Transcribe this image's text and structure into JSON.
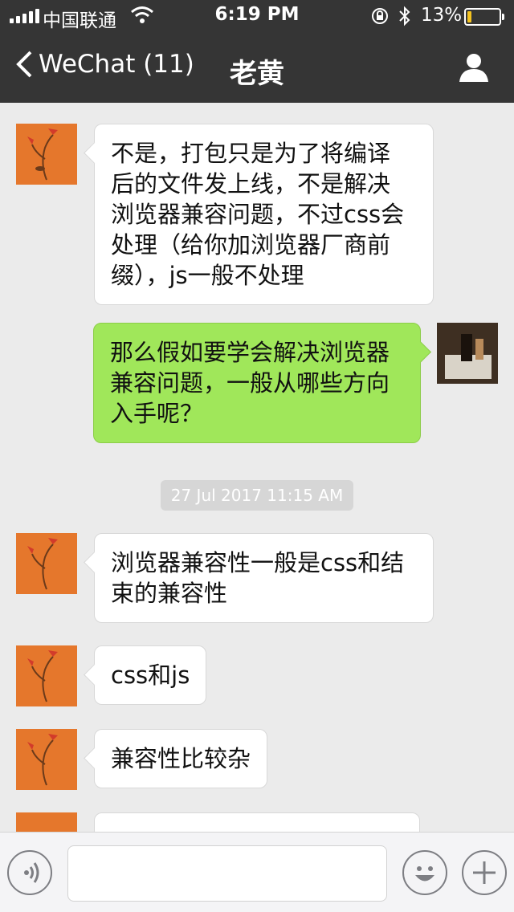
{
  "status_bar": {
    "carrier": "中国联通",
    "time": "6:19 PM",
    "battery_percent": "13%",
    "battery_level": 0.13,
    "battery_color": "#f4c320"
  },
  "nav": {
    "back_label": "WeChat (11)",
    "title": "老黄",
    "profile_icon": "person-icon"
  },
  "messages": [
    {
      "side": "in",
      "text": "不是，打包只是为了将编译\n后的文件发上线，不是解决\n浏览器兼容问题，不过css会\n处理（给你加浏览器厂商前\n缀），js一般不处理"
    },
    {
      "side": "out",
      "text": "那么假如要学会解决浏览器\n兼容问题，一般从哪些方向\n入手呢？"
    },
    {
      "side": "in",
      "text": "浏览器兼容性一般是css和结\n束的兼容性"
    },
    {
      "side": "in",
      "text": "css和js"
    },
    {
      "side": "in",
      "text": "兼容性比较杂"
    }
  ],
  "timestamp": "27 Jul 2017 11:15 AM",
  "input_bar": {
    "value": "",
    "placeholder": ""
  },
  "colors": {
    "nav_bg": "#353535",
    "chat_bg": "#ebebeb",
    "outgoing_bubble": "#a0e75a",
    "incoming_bubble": "#ffffff"
  }
}
